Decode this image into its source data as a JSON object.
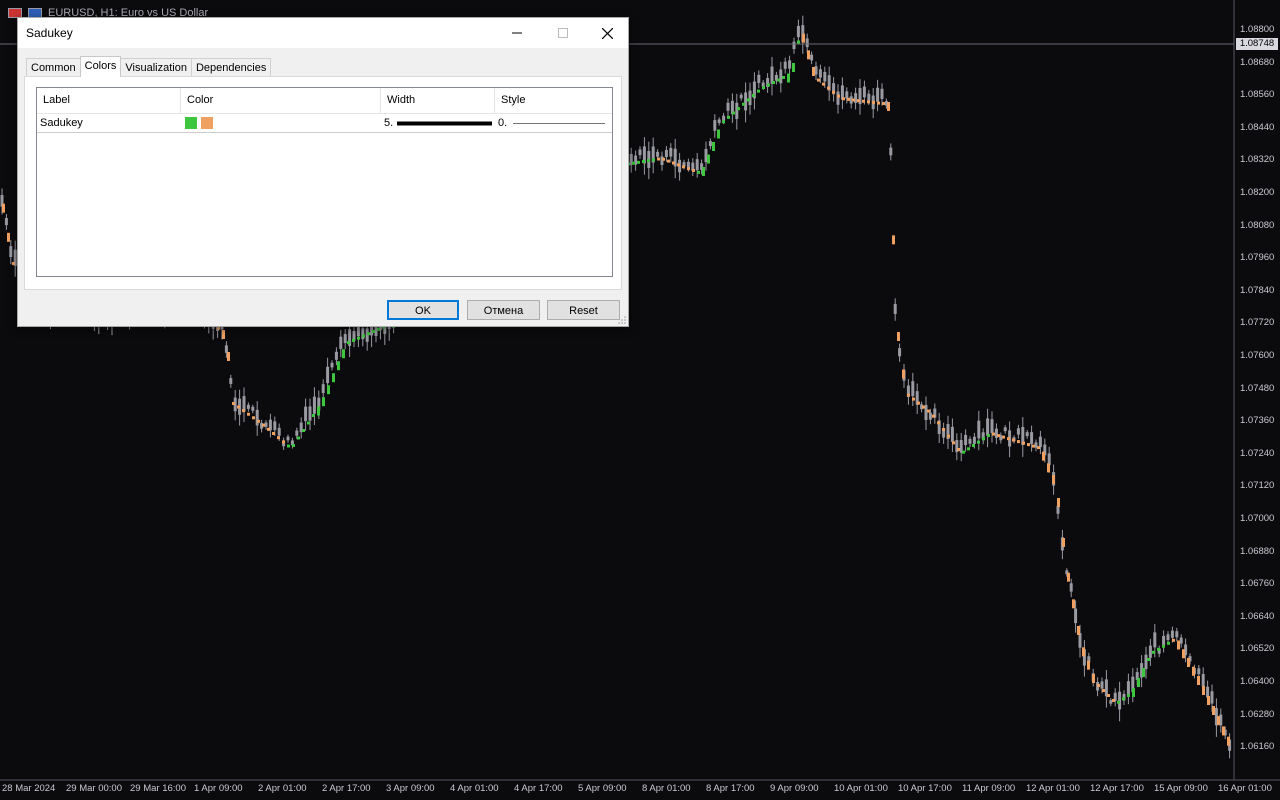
{
  "chart": {
    "caption": "EURUSD, H1:  Euro vs US Dollar",
    "current_price": "1.08748",
    "colors": {
      "background": "#0b0b0e",
      "candle": "#9a9aa3",
      "up": "#3ec63e",
      "down": "#f0a060"
    },
    "price_labels": [
      "1.08800",
      "1.08680",
      "1.08560",
      "1.08440",
      "1.08320",
      "1.08200",
      "1.08080",
      "1.07960",
      "1.07840",
      "1.07720",
      "1.07600",
      "1.07480",
      "1.07360",
      "1.07240",
      "1.07120",
      "1.07000",
      "1.06880",
      "1.06760",
      "1.06640",
      "1.06520",
      "1.06400",
      "1.06280",
      "1.06160"
    ],
    "time_labels": [
      "28 Mar 2024",
      "29 Mar 00:00",
      "29 Mar 16:00",
      "1 Apr 09:00",
      "2 Apr 01:00",
      "2 Apr 17:00",
      "3 Apr 09:00",
      "4 Apr 01:00",
      "4 Apr 17:00",
      "5 Apr 09:00",
      "8 Apr 01:00",
      "8 Apr 17:00",
      "9 Apr 09:00",
      "10 Apr 01:00",
      "10 Apr 17:00",
      "11 Apr 09:00",
      "12 Apr 01:00",
      "12 Apr 17:00",
      "15 Apr 09:00",
      "16 Apr 01:00"
    ]
  },
  "dialog": {
    "title": "Sadukey",
    "tabs": [
      "Common",
      "Colors",
      "Visualization",
      "Dependencies"
    ],
    "active_tab": "Colors",
    "grid": {
      "headers": {
        "label": "Label",
        "color": "Color",
        "width": "Width",
        "style": "Style"
      },
      "rows": [
        {
          "label": "Sadukey",
          "color1": "#3ec63e",
          "color2": "#f0a060",
          "width": "5.",
          "style": "0."
        }
      ]
    },
    "buttons": {
      "ok": "OK",
      "cancel": "Отмена",
      "reset": "Reset"
    }
  }
}
